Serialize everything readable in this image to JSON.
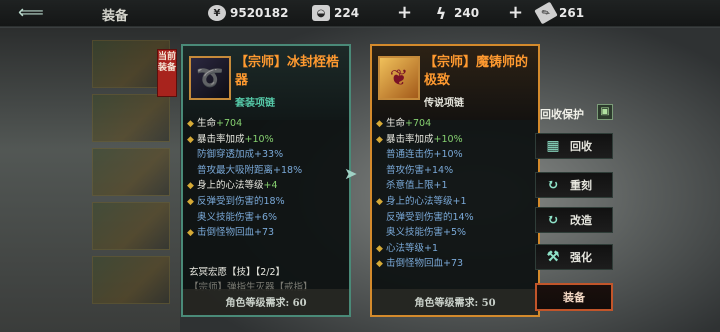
{
  "header": {
    "title": "装备",
    "resources": [
      {
        "icon": "coin-icon",
        "value": "9520182"
      },
      {
        "icon": "ingot-icon",
        "value": "224"
      },
      {
        "icon": "energy-icon",
        "value": "240"
      },
      {
        "icon": "ticket-icon",
        "value": "261"
      }
    ]
  },
  "current_label": "当前装备",
  "current": {
    "name": "【宗师】冰封桎梏器",
    "type": "套装项链",
    "stats": [
      {
        "k": "生命",
        "v": "+704",
        "marked": true,
        "style": "normal"
      },
      {
        "k": "暴击率加成",
        "v": "+10%",
        "marked": true,
        "style": "normal"
      },
      {
        "k": "防御穿透加成",
        "v": "+33%",
        "marked": false,
        "style": "blue"
      },
      {
        "k": "普攻最大吸附距离",
        "v": "+18%",
        "marked": false,
        "style": "blue"
      },
      {
        "k": "身上的心法等级",
        "v": "+4",
        "marked": true,
        "style": "normal"
      },
      {
        "k": "反弹受到伤害的",
        "v": "18%",
        "marked": true,
        "style": "blue"
      },
      {
        "k": "奥义技能伤害",
        "v": "+6%",
        "marked": false,
        "style": "blue"
      },
      {
        "k": "击倒怪物回血",
        "v": "+73",
        "marked": true,
        "style": "blue"
      }
    ],
    "suit_title": "玄冥宏愿【技】【2/2】",
    "suit_sub": "【宗师】弹指生灭器【戒指】",
    "requirement": "角色等级需求: 60"
  },
  "candidate": {
    "name": "【宗师】魔铸师的极致",
    "type": "传说项链",
    "stats": [
      {
        "k": "生命",
        "v": "+704",
        "marked": true,
        "style": "normal"
      },
      {
        "k": "暴击率加成",
        "v": "+10%",
        "marked": true,
        "style": "normal"
      },
      {
        "k": "普通连击伤",
        "v": "+10%",
        "marked": false,
        "style": "blue"
      },
      {
        "k": "普攻伤害",
        "v": "+14%",
        "marked": false,
        "style": "blue"
      },
      {
        "k": "杀意值上限",
        "v": "+1",
        "marked": false,
        "style": "blue"
      },
      {
        "k": "身上的心法等级",
        "v": "+1",
        "marked": true,
        "style": "blue"
      },
      {
        "k": "反弹受到伤害的",
        "v": "14%",
        "marked": false,
        "style": "blue"
      },
      {
        "k": "奥义技能伤害",
        "v": "+5%",
        "marked": false,
        "style": "blue"
      },
      {
        "k": "心法等级",
        "v": "+1",
        "marked": true,
        "style": "blue"
      },
      {
        "k": "击倒怪物回血",
        "v": "+73",
        "marked": true,
        "style": "blue"
      }
    ],
    "requirement": "角色等级需求: 50"
  },
  "actions": {
    "recycle_protect": "回收保护",
    "recycle": "回收",
    "reforge": "重刻",
    "refine": "改造",
    "enhance": "强化",
    "equip": "装备"
  }
}
